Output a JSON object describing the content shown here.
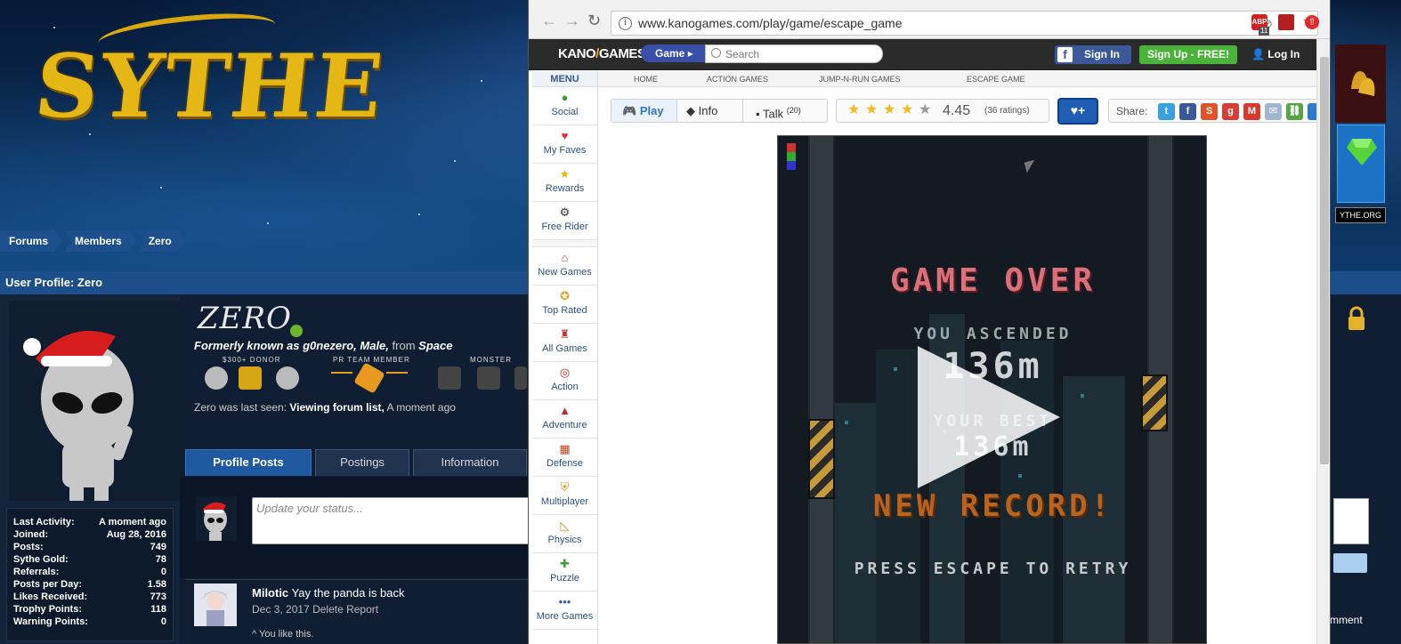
{
  "forum": {
    "logo": "SYTHE",
    "breadcrumb": [
      "Forums",
      "Members",
      "Zero"
    ],
    "profile_header": "User Profile: Zero",
    "user": {
      "name": "ZERO",
      "formerly_prefix": "Formerly known as g0nezero, Male,",
      "from_word": "from",
      "location": "Space",
      "badge_labels": [
        "$300+ DONOR",
        "PR TEAM MEMBER",
        "MONSTER"
      ],
      "last_seen_prefix": "Zero was last seen:",
      "last_seen_action": "Viewing forum list,",
      "last_seen_time": "A moment ago"
    },
    "stats": [
      {
        "label": "Last Activity:",
        "value": "A moment ago"
      },
      {
        "label": "Joined:",
        "value": "Aug 28, 2016"
      },
      {
        "label": "Posts:",
        "value": "749"
      },
      {
        "label": "Sythe Gold:",
        "value": "78"
      },
      {
        "label": "Referrals:",
        "value": "0"
      },
      {
        "label": "Posts per Day:",
        "value": "1.58"
      },
      {
        "label": "Likes Received:",
        "value": "773"
      },
      {
        "label": "Trophy Points:",
        "value": "118"
      },
      {
        "label": "Warning Points:",
        "value": "0"
      }
    ],
    "tabs": [
      "Profile Posts",
      "Postings",
      "Information"
    ],
    "status_placeholder": "Update your status...",
    "post": {
      "author": "Milotic",
      "text": "Yay the panda is back",
      "date": "Dec 3, 2017",
      "delete": "Delete",
      "report": "Report",
      "like": "^ You like this."
    },
    "right_site_label": "YTHE.ORG",
    "right_comment": "mment"
  },
  "browser": {
    "url": "www.kanogames.com/play/game/escape_game",
    "ext_badge": "11",
    "site": {
      "logo_left": "KANO",
      "logo_right": "GAMES",
      "game_pill": "Game",
      "search_placeholder": "Search",
      "fb_signin": "Sign In",
      "signup": "Sign Up - FREE!",
      "login": "Log In",
      "menu_label": "MENU",
      "sidebar": [
        {
          "label": "Social",
          "icon": "person-icon"
        },
        {
          "label": "My Faves",
          "icon": "heart-icon"
        },
        {
          "label": "Rewards",
          "icon": "star-icon"
        },
        {
          "label": "Free Rider",
          "icon": "bike-icon"
        },
        {
          "label": "New Games",
          "icon": "house-icon"
        },
        {
          "label": "Top Rated",
          "icon": "medal-icon"
        },
        {
          "label": "All Games",
          "icon": "joystick-icon"
        },
        {
          "label": "Action",
          "icon": "target-icon"
        },
        {
          "label": "Adventure",
          "icon": "rocket-icon"
        },
        {
          "label": "Defense",
          "icon": "wall-icon"
        },
        {
          "label": "Multiplayer",
          "icon": "shield-icon"
        },
        {
          "label": "Physics",
          "icon": "ruler-icon"
        },
        {
          "label": "Puzzle",
          "icon": "puzzle-icon"
        },
        {
          "label": "More Games",
          "icon": "dots-icon"
        }
      ],
      "crumbs": [
        "HOME",
        "ACTION GAMES",
        "JUMP-N-RUN GAMES",
        "ESCAPE GAME"
      ],
      "tabs": {
        "play": "Play",
        "info": "Info",
        "talk": "Talk",
        "talk_count": "(20)"
      },
      "rating": {
        "value": "4.45",
        "count": "(36 ratings)",
        "stars": 4.45
      },
      "fave_button": "♥+",
      "share_label": "Share:",
      "game": {
        "title": "GAME OVER",
        "ascended_label": "YOU ASCENDED",
        "ascended_value": "136m",
        "best_label": "YOUR BEST",
        "best_value": "136m",
        "record": "NEW RECORD!",
        "retry": "PRESS ESCAPE TO RETRY"
      }
    }
  },
  "colors": {
    "forum_blue": "#1c4f8a",
    "kano_orange": "#f5a80a",
    "game_over_red": "#d9707a",
    "record_orange": "#b8641e"
  }
}
